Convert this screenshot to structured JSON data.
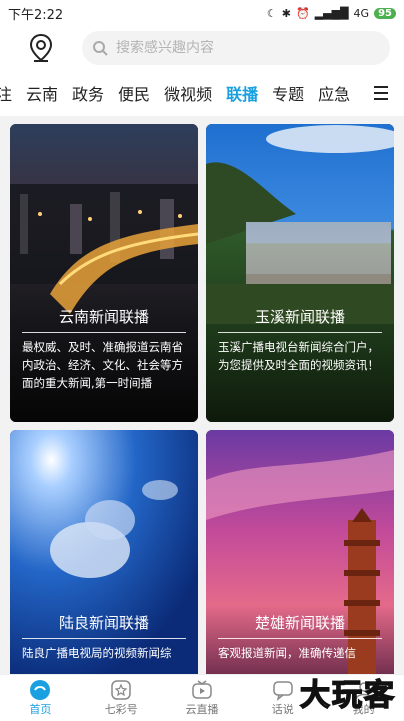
{
  "status": {
    "time": "下午2:22",
    "signal": "4G",
    "battery": "95"
  },
  "search": {
    "placeholder": "搜索感兴趣内容"
  },
  "tabs": [
    "注",
    "云南",
    "政务",
    "便民",
    "微视频",
    "联播",
    "专题",
    "应急"
  ],
  "active_tab": "联播",
  "cards": [
    {
      "title": "云南新闻联播",
      "desc": "最权威、及时、准确报道云南省内政治、经济、文化、社会等方面的重大新闻,第一时间播"
    },
    {
      "title": "玉溪新闻联播",
      "desc": "玉溪广播电视台新闻综合门户，为您提供及时全面的视频资讯！"
    },
    {
      "title": "陆良新闻联播",
      "desc": "陆良广播电视局的视频新闻综"
    },
    {
      "title": "楚雄新闻联播",
      "desc": "客观报道新闻，准确传递信"
    }
  ],
  "bottom_nav": [
    "首页",
    "七彩号",
    "云直播",
    "话说",
    "我的"
  ],
  "watermark": "大玩客",
  "colors": {
    "accent": "#1aa0e0"
  }
}
